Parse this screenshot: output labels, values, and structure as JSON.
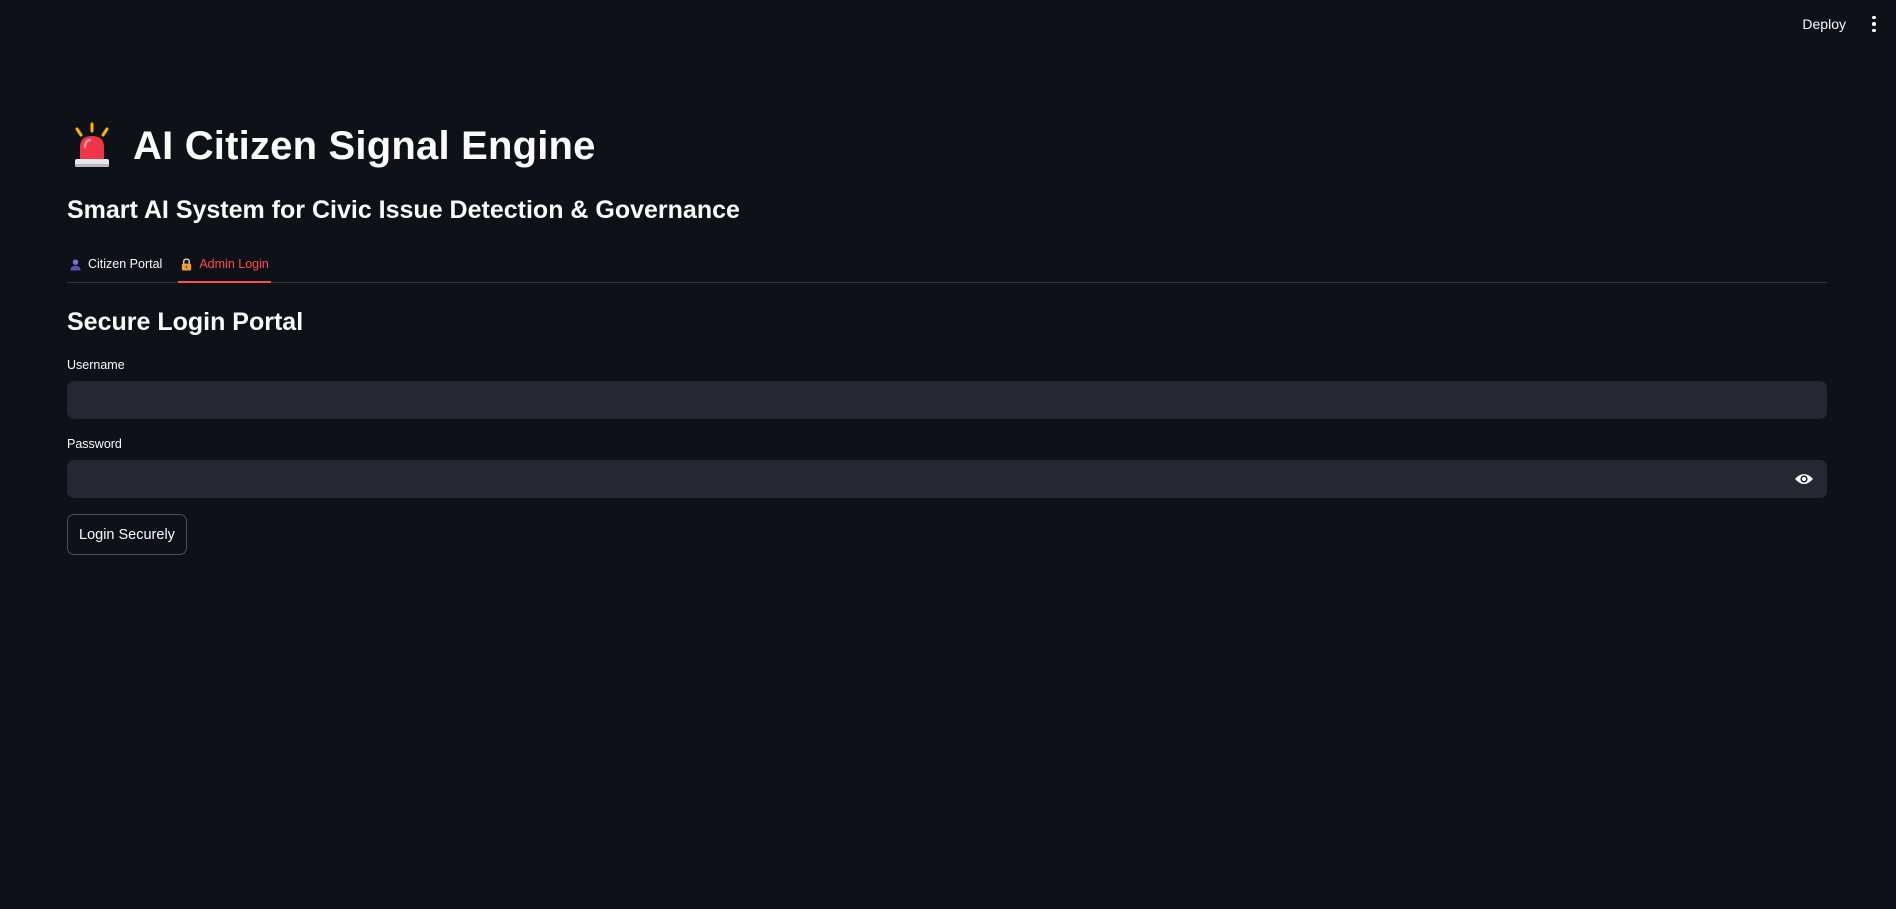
{
  "toolbar": {
    "deploy_label": "Deploy",
    "menu_icon": "kebab-menu-icon"
  },
  "header": {
    "title_icon": "police-light-icon",
    "title": "AI Citizen Signal Engine",
    "subtitle": "Smart AI System for Civic Issue Detection & Governance"
  },
  "tabs": [
    {
      "label": "Citizen Portal",
      "icon": "person-icon",
      "active": false
    },
    {
      "label": "Admin Login",
      "icon": "lock-icon",
      "active": true
    }
  ],
  "login": {
    "heading": "Secure Login Portal",
    "username_label": "Username",
    "username_value": "",
    "password_label": "Password",
    "password_value": "",
    "toggle_icon": "eye-icon",
    "submit_label": "Login Securely"
  },
  "colors": {
    "background": "#0e1117",
    "input_background": "#262730",
    "accent": "#ff4b4b",
    "text": "#fafafa"
  }
}
